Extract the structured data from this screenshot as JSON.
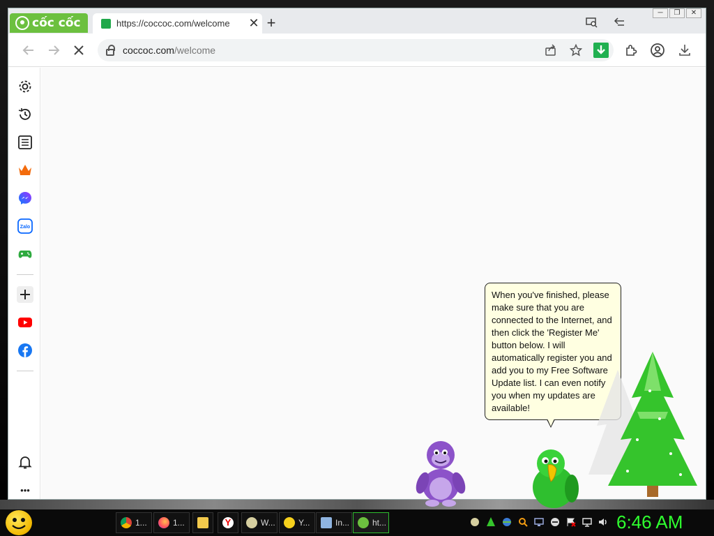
{
  "browser": {
    "brand": "cốc cốc",
    "tab": {
      "title": "https://coccoc.com/welcome",
      "close_glyph": "✕"
    },
    "new_tab_glyph": "+",
    "address": {
      "host": "coccoc.com",
      "path": "/welcome"
    },
    "window_controls": [
      "─",
      "❐",
      "✕"
    ]
  },
  "sidebar": {
    "items": [
      "settings",
      "history",
      "reading-list",
      "coccoc-games-crown",
      "messenger",
      "zalo",
      "games",
      "add",
      "youtube",
      "facebook",
      "notifications",
      "more"
    ],
    "zalo_label": "Zalo",
    "more_glyph": "•••"
  },
  "assistant": {
    "balloon_text": "When you've finished, please make sure that you are connected to the Internet, and then click the 'Register Me' button below. I will automatically register you and add you to my Free Software Update list. I can even notify you when my updates are available!"
  },
  "taskbar": {
    "buttons": [
      {
        "label": "1...",
        "icon": "chrome-icon"
      },
      {
        "label": "1...",
        "icon": "firefox-icon"
      },
      {
        "label": "",
        "icon": "folder-icon"
      },
      {
        "label": "",
        "icon": "yandex-icon"
      },
      {
        "label": "W...",
        "icon": "bonzi-app-icon"
      },
      {
        "label": "Y...",
        "icon": "smiley-icon"
      },
      {
        "label": "In...",
        "icon": "installer-icon"
      },
      {
        "label": "ht...",
        "icon": "coccoc-icon"
      }
    ],
    "clock": "6:46 AM"
  },
  "colors": {
    "brand_green": "#6cc03f",
    "clock_green": "#2fff2f",
    "balloon_bg": "#ffffe1"
  }
}
